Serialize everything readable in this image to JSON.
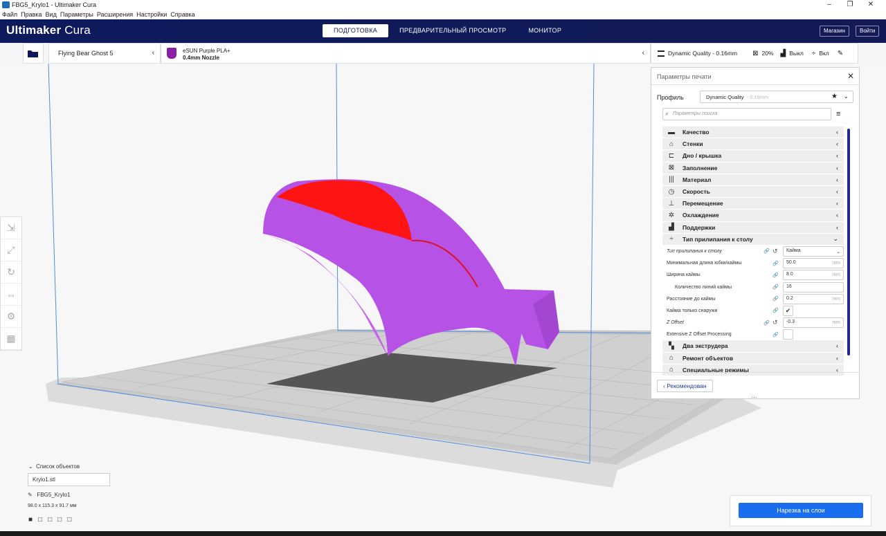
{
  "window": {
    "title": "FBG5_Krylo1 - Ultimaker Cura",
    "min": "–",
    "max": "❐",
    "close": "✕"
  },
  "menu": [
    "Файл",
    "Правка",
    "Вид",
    "Параметры",
    "Расширения",
    "Настройки",
    "Справка"
  ],
  "brand": {
    "bold": "Ultimaker",
    "light": " Cura"
  },
  "stages": [
    {
      "label": "ПОДГОТОВКА",
      "active": true
    },
    {
      "label": "ПРЕДВАРИТЕЛЬНЫЙ ПРОСМОТР",
      "active": false
    },
    {
      "label": "МОНИТОР",
      "active": false
    }
  ],
  "header_buttons": {
    "market": "Магазин",
    "login": "Войти"
  },
  "printer": {
    "name": "Flying Bear Ghost 5"
  },
  "material": {
    "name": "eSUN Purple PLA+",
    "nozzle": "0.4mm Nozzle",
    "color": "#8c1fa3"
  },
  "quality": {
    "profile": "Dynamic Quality - 0.16mm",
    "infill": "20%",
    "support": "Выкл",
    "adhesion": "Вкл"
  },
  "panel": {
    "title": "Параметры печати",
    "profile_label": "Профиль",
    "profile_value": "Dynamic Quality",
    "profile_sub": "- 0.16mm",
    "search_placeholder": "Параметры поиска",
    "categories_top": [
      {
        "label": "Качество",
        "icon": "▬"
      },
      {
        "label": "Стенки",
        "icon": "⌂"
      },
      {
        "label": "Дно / крышка",
        "icon": "⊏"
      },
      {
        "label": "Заполнение",
        "icon": "⊠"
      },
      {
        "label": "Материал",
        "icon": "|||"
      },
      {
        "label": "Скорость",
        "icon": "◷"
      },
      {
        "label": "Перемещение",
        "icon": "⊥"
      },
      {
        "label": "Охлаждение",
        "icon": "✲"
      },
      {
        "label": "Поддержки",
        "icon": "▟"
      }
    ],
    "expanded_category": {
      "label": "Тип прилипания к столу",
      "icon": "÷"
    },
    "settings": [
      {
        "name": "Тип прилипания к столу",
        "value": "Кайма",
        "unit": "",
        "italic": true,
        "kind": "select"
      },
      {
        "name": "Минимальная длина юбки/каймы",
        "value": "50.0",
        "unit": "mm",
        "kind": "text"
      },
      {
        "name": "Ширина каймы",
        "value": "8.0",
        "unit": "mm",
        "kind": "text"
      },
      {
        "name": "Количество линий каймы",
        "value": "16",
        "unit": "",
        "kind": "text",
        "indent": true
      },
      {
        "name": "Расстояние до каймы",
        "value": "0.2",
        "unit": "mm",
        "kind": "text"
      },
      {
        "name": "Кайма только снаружи",
        "value": "✔",
        "unit": "",
        "kind": "check"
      },
      {
        "name": "Z Offset",
        "value": "-0.3",
        "unit": "mm",
        "italic": true,
        "kind": "text"
      },
      {
        "name": "Extensive Z Offset Processing",
        "value": "",
        "unit": "",
        "kind": "check"
      }
    ],
    "categories_bottom": [
      {
        "label": "Два экструдера",
        "icon": "▚"
      },
      {
        "label": "Ремонт объектов",
        "icon": "⌂"
      },
      {
        "label": "Специальные режимы",
        "icon": "⌂"
      }
    ],
    "recommended": "Рекомендован"
  },
  "objects": {
    "header": "Список объектов",
    "file": "Krylo1.stl",
    "name": "FBG5_Krylo1",
    "dims": "98.0 x 115.3 x 91.7 мм"
  },
  "slice_button": "Нарезка на слои"
}
